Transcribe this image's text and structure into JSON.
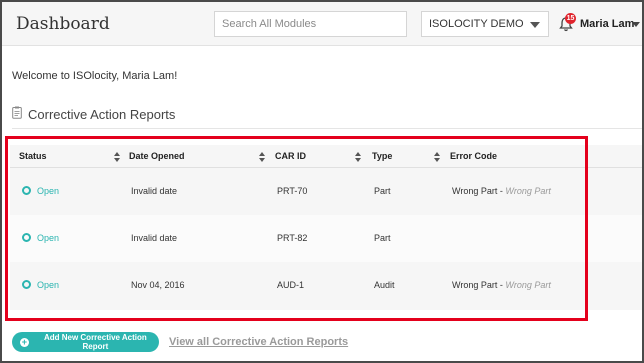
{
  "header": {
    "title": "Dashboard",
    "search_placeholder": "Search All Modules",
    "org_select": "ISOLOCITY DEMO",
    "notification_count": "15",
    "user_name": "Maria Lam"
  },
  "welcome_text": "Welcome to ISOlocity, Maria Lam!",
  "section": {
    "title": "Corrective Action Reports"
  },
  "table": {
    "columns": [
      "Status",
      "Date Opened",
      "CAR ID",
      "Type",
      "Error Code"
    ],
    "rows": [
      {
        "status": "Open",
        "date_opened": "Invalid date",
        "car_id": "PRT-70",
        "type": "Part",
        "error_code": "Wrong Part - ",
        "error_sub": "Wrong Part"
      },
      {
        "status": "Open",
        "date_opened": "Invalid date",
        "car_id": "PRT-82",
        "type": "Part",
        "error_code": "",
        "error_sub": ""
      },
      {
        "status": "Open",
        "date_opened": "Nov 04, 2016",
        "car_id": "AUD-1",
        "type": "Audit",
        "error_code": "Wrong Part - ",
        "error_sub": "Wrong Part"
      }
    ]
  },
  "actions": {
    "add_label": "Add New Corrective Action Report",
    "view_all_label": "View all Corrective Action Reports"
  },
  "colors": {
    "accent": "#2bb5b0",
    "highlight": "#e4001c",
    "badge": "#e0242d"
  }
}
